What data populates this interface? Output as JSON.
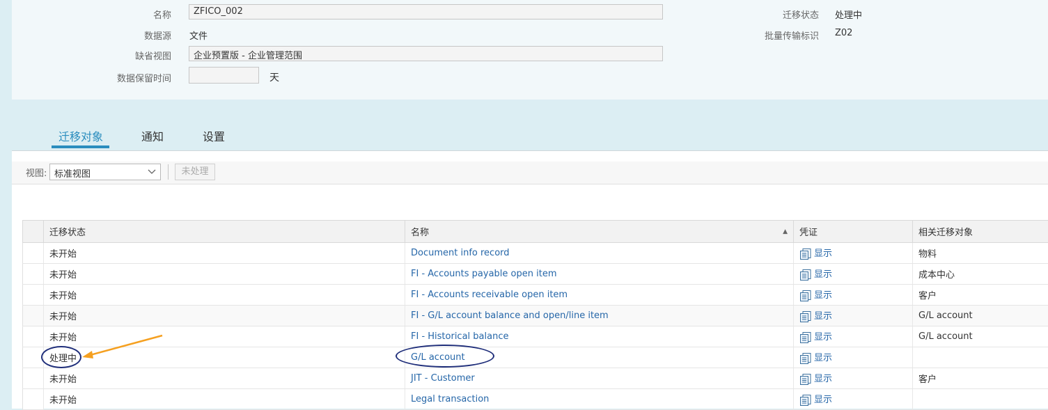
{
  "form": {
    "name_label": "名称",
    "name_value": "ZFICO_002",
    "source_label": "数据源",
    "source_value": "文件",
    "view_label": "缺省视图",
    "view_value": "企业预置版 - 企业管理范围",
    "retention_label": "数据保留时间",
    "retention_value": "",
    "retention_unit": "天",
    "status_label": "迁移状态",
    "status_value": "处理中",
    "batch_label": "批量传输标识",
    "batch_value": "Z02"
  },
  "tabs": [
    "迁移对象",
    "通知",
    "设置"
  ],
  "active_tab": 0,
  "toolbar": {
    "view_label": "视图:",
    "view_value": "标准视图",
    "unprocessed_button": "未处理"
  },
  "table": {
    "headers": [
      "迁移状态",
      "名称",
      "凭证",
      "相关迁移对象"
    ],
    "rows": [
      {
        "status": "未开始",
        "name": "Document info record",
        "doc": "显示",
        "related": "物料"
      },
      {
        "status": "未开始",
        "name": "FI - Accounts payable open item",
        "doc": "显示",
        "related": "成本中心"
      },
      {
        "status": "未开始",
        "name": "FI - Accounts receivable open item",
        "doc": "显示",
        "related": "客户"
      },
      {
        "status": "未开始",
        "name": "FI - G/L account balance and open/line item",
        "doc": "显示",
        "related": "G/L account"
      },
      {
        "status": "未开始",
        "name": "FI - Historical balance",
        "doc": "显示",
        "related": "G/L account"
      },
      {
        "status": "处理中",
        "name": "G/L account",
        "doc": "显示",
        "related": ""
      },
      {
        "status": "未开始",
        "name": "JIT - Customer",
        "doc": "显示",
        "related": "客户"
      },
      {
        "status": "未开始",
        "name": "Legal transaction",
        "doc": "显示",
        "related": ""
      }
    ]
  },
  "annotation_colors": {
    "ellipse": "#1f2e7a",
    "arrow": "#f5a020"
  },
  "accent_color": "#2a8dbe",
  "link_color": "#2566a8"
}
